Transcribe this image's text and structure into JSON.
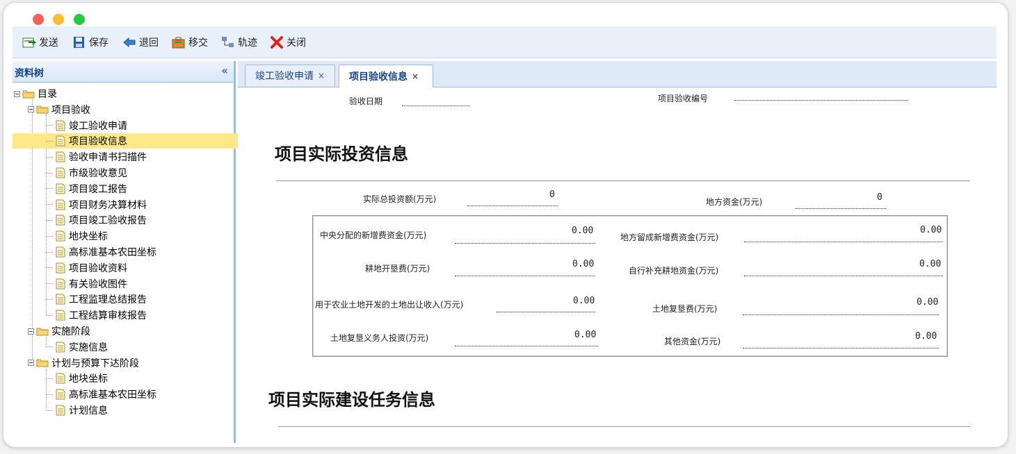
{
  "toolbar": {
    "send": "发送",
    "save": "保存",
    "return": "退回",
    "transfer": "移交",
    "track": "轨迹",
    "close": "关闭"
  },
  "sidebar": {
    "title": "资料树",
    "collapse_glyph": "«",
    "root": "目录",
    "groups": [
      {
        "label": "项目验收",
        "items": [
          "竣工验收申请",
          "项目验收信息",
          "验收申请书扫描件",
          "市级验收意见",
          "项目竣工报告",
          "项目财务决算材料",
          "项目竣工验收报告",
          "地块坐标",
          "高标准基本农田坐标",
          "项目验收资料",
          "有关验收图件",
          "工程监理总结报告",
          "工程结算审核报告"
        ]
      },
      {
        "label": "实施阶段",
        "items": [
          "实施信息"
        ]
      },
      {
        "label": "计划与预算下达阶段",
        "items": [
          "地块坐标",
          "高标准基本农田坐标",
          "计划信息"
        ]
      }
    ]
  },
  "tabs": [
    {
      "label": "竣工验收申请",
      "close": "×"
    },
    {
      "label": "项目验收信息",
      "close": "×"
    }
  ],
  "form": {
    "acceptance_date_label": "验收日期",
    "acceptance_date_value": "",
    "acceptance_no_label": "项目验收编号",
    "acceptance_no_value": "",
    "section1_title": "项目实际投资信息",
    "total_invest_label": "实际总投资额(万元)",
    "total_invest_value": "0",
    "local_fund_label": "地方资金(万元)",
    "local_fund_value": "0",
    "central_new_fee_label": "中央分配的新增费资金(万元)",
    "central_new_fee_value": "0.00",
    "local_new_fee_label": "地方留成新增费资金(万元)",
    "local_new_fee_value": "0.00",
    "reclaim_fee_label": "耕地开垦费(万元)",
    "reclaim_fee_value": "0.00",
    "self_supp_label": "自行补充耕地资金(万元)",
    "self_supp_value": "0.00",
    "land_transfer_label": "用于农业土地开发的土地出让收入(万元)",
    "land_transfer_value": "0.00",
    "restore_fee_label": "土地复垦费(万元)",
    "restore_fee_value": "0.00",
    "restore_obligor_label": "土地复垦义务人投资(万元)",
    "restore_obligor_value": "0.00",
    "other_fund_label": "其他资金(万元)",
    "other_fund_value": "0.00",
    "section2_title": "项目实际建设任务信息"
  },
  "colors": {
    "selected_row": "#ffe88a",
    "panel_border": "#99bbe8",
    "header_text": "#15428b",
    "toolbar_bg": "#e8f1fa"
  }
}
